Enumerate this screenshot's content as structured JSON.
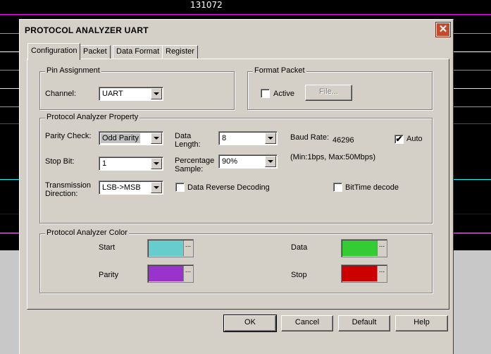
{
  "background": {
    "scope_label": "131072",
    "trace_colors": [
      "#ff00ff",
      "#00ff00",
      "#ffffff",
      "#8080ff",
      "#ffff00",
      "#ff8000",
      "#ff0000",
      "#00ffff",
      "#0000ff",
      "#ff80ff"
    ]
  },
  "dialog": {
    "title": "PROTOCOL ANALYZER UART",
    "close_glyph": "✕",
    "tabs": [
      {
        "label": "Configuration",
        "active": true
      },
      {
        "label": "Packet",
        "active": false
      },
      {
        "label": "Data Format",
        "active": false
      },
      {
        "label": "Register",
        "active": false
      }
    ]
  },
  "pin_assignment": {
    "legend": "Pin Assignment",
    "channel_label": "Channel:",
    "channel_value": "UART"
  },
  "format_packet": {
    "legend": "Format Packet",
    "active_label": "Active",
    "active_checked": false,
    "file_button": "File..."
  },
  "property": {
    "legend": "Protocol Analyzer Property",
    "parity_label": "Parity Check:",
    "parity_value": "Odd Parity",
    "stop_bit_label": "Stop Bit:",
    "stop_bit_value": "1",
    "direction_label_1": "Transmission",
    "direction_label_2": "Direction:",
    "direction_value": "LSB->MSB",
    "data_length_label_1": "Data",
    "data_length_label_2": "Length:",
    "data_length_value": "8",
    "percentage_label_1": "Percentage",
    "percentage_label_2": "Sample:",
    "percentage_value": "90%",
    "baud_label": "Baud Rate:",
    "baud_value": "46296",
    "auto_label": "Auto",
    "auto_checked": true,
    "range_note": "(Min:1bps, Max:50Mbps)",
    "data_reverse_label": "Data Reverse Decoding",
    "data_reverse_checked": false,
    "bittime_label": "BitTime decode",
    "bittime_checked": false
  },
  "colors": {
    "legend": "Protocol Analyzer Color",
    "start_label": "Start",
    "start_color": "#66cccc",
    "parity_label": "Parity",
    "parity_color": "#9933cc",
    "data_label": "Data",
    "data_color": "#33cc33",
    "stop_label": "Stop",
    "stop_color": "#cc0000",
    "ellipsis": "..."
  },
  "buttons": {
    "ok": "OK",
    "cancel": "Cancel",
    "default": "Default",
    "help": "Help"
  },
  "check_glyph": "✔"
}
